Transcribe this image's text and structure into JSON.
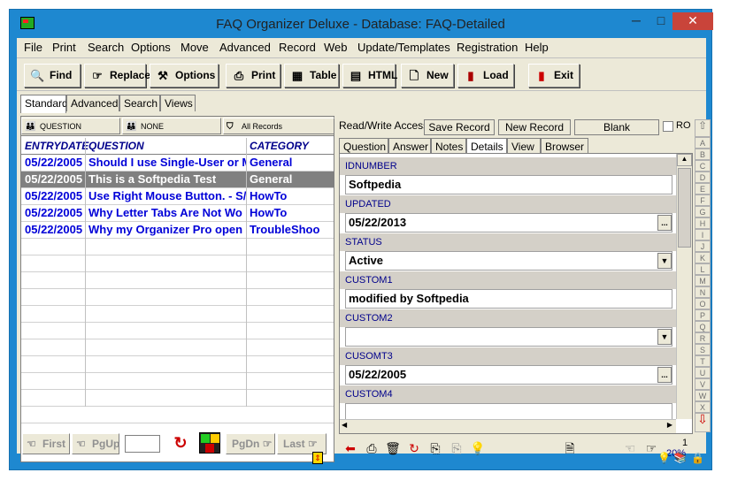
{
  "window": {
    "title": "FAQ Organizer Deluxe - Database: FAQ-Detailed",
    "min": "─",
    "max": "□",
    "close": "✕"
  },
  "menu": [
    "File",
    "Print",
    "Search",
    "Options",
    "Move",
    "Advanced",
    "Record",
    "Web",
    "Update/Templates",
    "Registration",
    "Help"
  ],
  "toolbar": {
    "find": "Find",
    "replace": "Replace",
    "options": "Options",
    "print": "Print",
    "table": "Table",
    "html": "HTML",
    "new": "New",
    "load": "Load",
    "exit": "Exit"
  },
  "mode_tabs": [
    "Standard",
    "Advanced",
    "Search",
    "Views"
  ],
  "sort_header": {
    "first": "QUESTION",
    "second": "NONE",
    "third": "All Records"
  },
  "grid": {
    "columns": [
      "ENTRYDATE",
      "QUESTION",
      "CATEGORY"
    ],
    "rows": [
      [
        "05/22/2005",
        "Should I use Single-User or Mul",
        "General"
      ],
      [
        "05/22/2005",
        "This is a Softpedia Test",
        "General"
      ],
      [
        "05/22/2005",
        "Use Right Mouse Button. - S/",
        "HowTo"
      ],
      [
        "05/22/2005",
        "Why Letter Tabs Are Not Wo",
        "HowTo"
      ],
      [
        "05/22/2005",
        "Why my Organizer Pro open",
        "TroubleShoo"
      ]
    ]
  },
  "nav": {
    "first": "First",
    "pgup": "PgUp",
    "pgdn": "PgDn",
    "last": "Last"
  },
  "record_bar": {
    "access": "Read/Write Access",
    "save": "Save Record",
    "new": "New Record",
    "blank": "Blank",
    "ro": "RO"
  },
  "detail_tabs": [
    "Question",
    "Answer",
    "Notes",
    "Details",
    "View",
    "Browser"
  ],
  "fields": [
    {
      "label": "IDNUMBER",
      "value": "Softpedia",
      "kind": "text"
    },
    {
      "label": "UPDATED",
      "value": "05/22/2013",
      "kind": "ellipsis"
    },
    {
      "label": "STATUS",
      "value": "Active",
      "kind": "dropdown"
    },
    {
      "label": "CUSTOM1",
      "value": "modified by Softpedia",
      "kind": "text"
    },
    {
      "label": "CUSTOM2",
      "value": "",
      "kind": "dropdown"
    },
    {
      "label": "CUSOMT3",
      "value": "05/22/2005",
      "kind": "ellipsis"
    },
    {
      "label": "CUSTOM4",
      "value": "",
      "kind": "text"
    }
  ],
  "alpha_tabs": [
    "A",
    "B",
    "C",
    "D",
    "E",
    "F",
    "G",
    "H",
    "I",
    "J",
    "K",
    "L",
    "M",
    "N",
    "O",
    "P",
    "Q",
    "R",
    "S",
    "T",
    "U",
    "V",
    "W",
    "X"
  ],
  "status": {
    "page": "1",
    "zoom": "20%"
  }
}
